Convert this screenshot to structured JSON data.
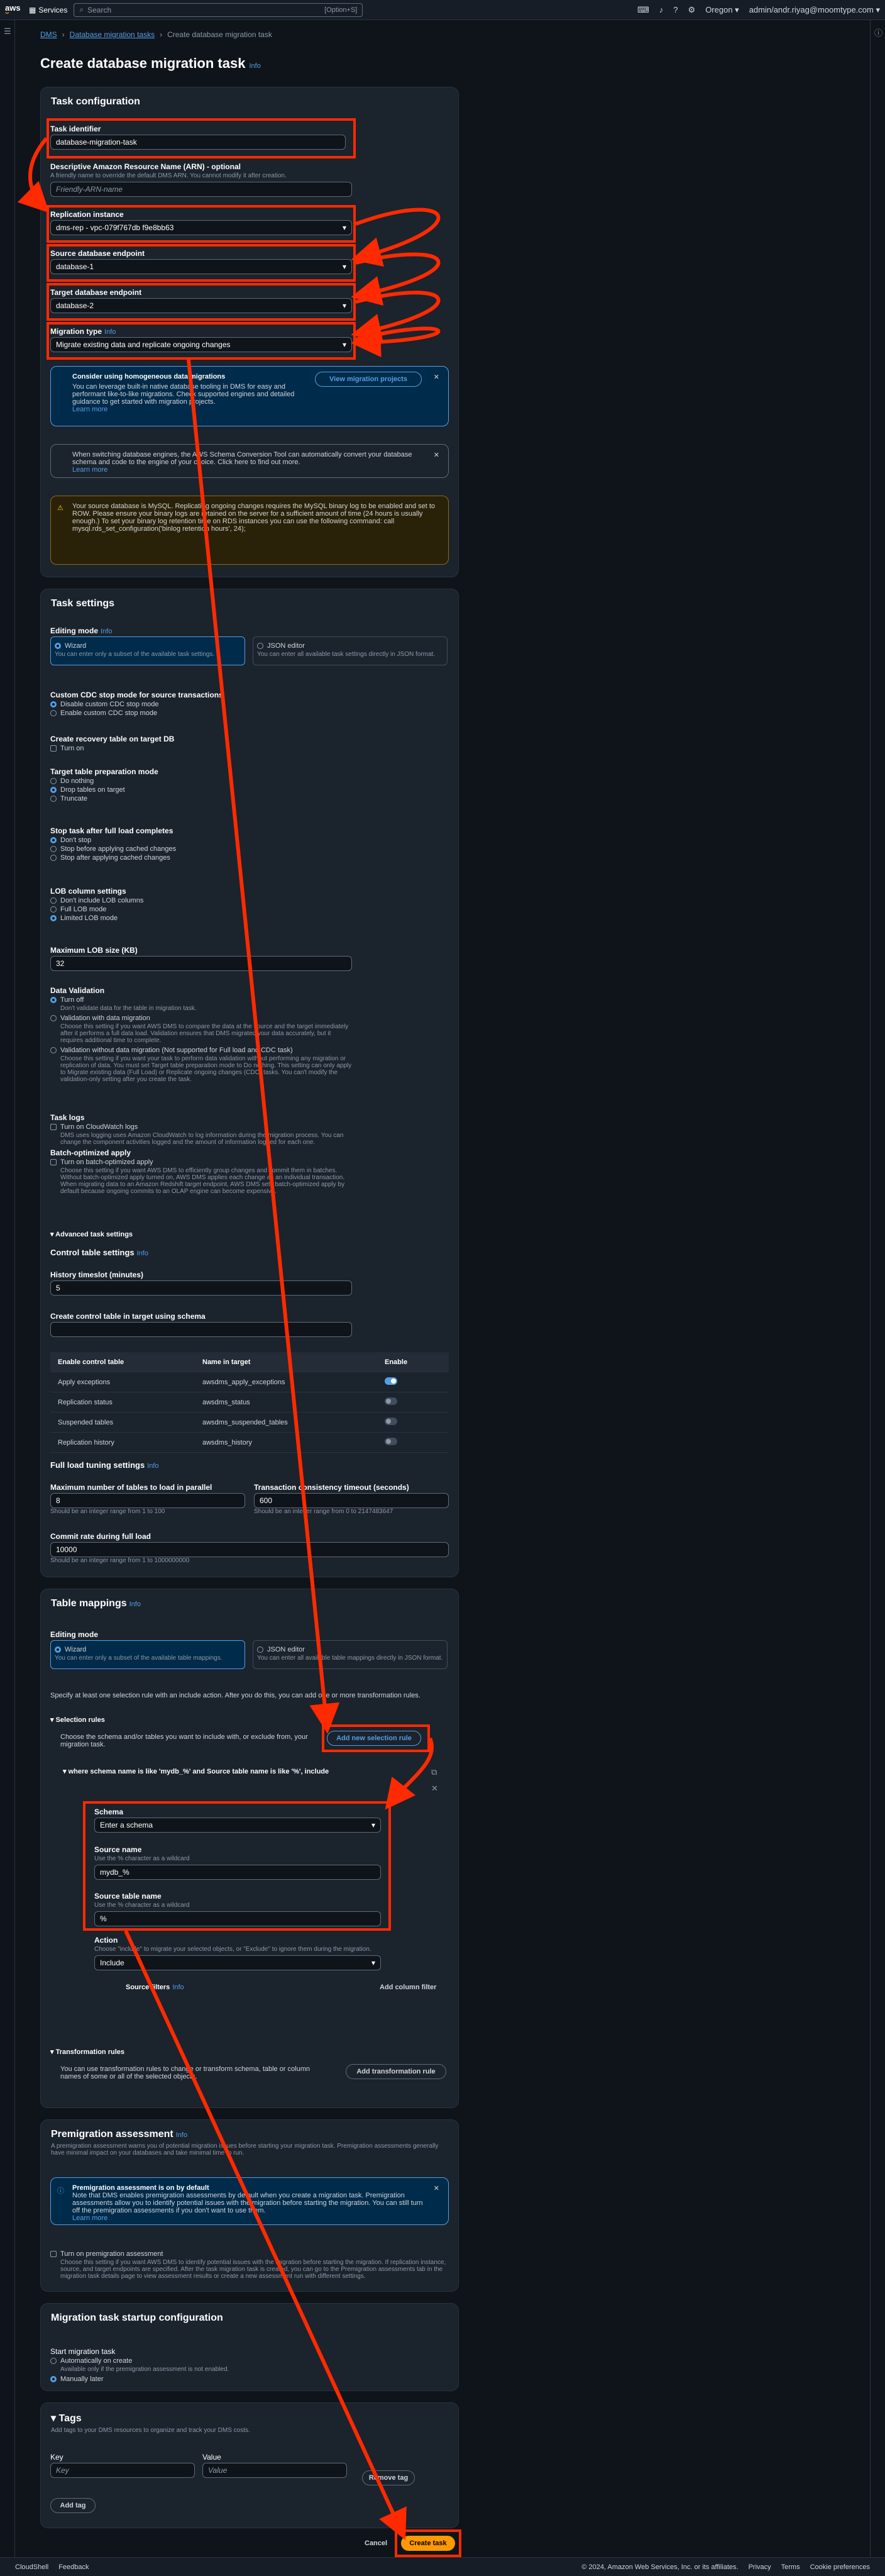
{
  "topbar": {
    "services": "Services",
    "search_placeholder": "Search",
    "search_hint": "[Option+S]",
    "region": "Oregon ▾",
    "account": "admin/andr.riyag@moomtype.com ▾"
  },
  "breadcrumb": [
    "DMS",
    "Database migration tasks",
    "Create database migration task"
  ],
  "page": {
    "title": "Create database migration task",
    "info": "Info"
  },
  "task_config": {
    "title": "Task configuration",
    "task_identifier": {
      "label": "Task identifier",
      "value": "database-migration-task"
    },
    "arn": {
      "label": "Descriptive Amazon Resource Name (ARN) - optional",
      "desc": "A friendly name to override the default DMS ARN. You cannot modify it after creation.",
      "placeholder": "Friendly-ARN-name"
    },
    "replication_instance": {
      "label": "Replication instance",
      "value": "dms-rep - vpc-079f767db f9e8bb63"
    },
    "source": {
      "label": "Source database endpoint",
      "value": "database-1"
    },
    "target": {
      "label": "Target database endpoint",
      "value": "database-2"
    },
    "migration_type": {
      "label": "Migration type",
      "value": "Migrate existing data and replicate ongoing changes"
    },
    "alert1": {
      "title": "Consider using homogeneous data migrations",
      "text": "You can leverage built-in native database tooling in DMS for easy and performant like-to-like migrations. Check supported engines and detailed guidance to get started with migration projects.",
      "link": "Learn more",
      "button": "View migration projects"
    },
    "alert2": {
      "text": "When switching database engines, the AWS Schema Conversion Tool can automatically convert your database schema and code to the engine of your choice. Click here to find out more.",
      "link": "Learn more"
    },
    "alert3": {
      "text": "Your source database is MySQL. Replicating ongoing changes requires the MySQL binary log to be enabled and set to ROW. Please ensure your binary logs are retained on the server for a sufficient amount of time (24 hours is usually enough.) To set your binary log retention time on RDS instances you can use the following command: call mysql.rds_set_configuration('binlog retention hours', 24);"
    }
  },
  "task_settings": {
    "title": "Task settings",
    "editing_mode": "Editing mode",
    "wizard": "Wizard",
    "wizard_desc": "You can enter only a subset of the available task settings.",
    "json": "JSON editor",
    "json_desc": "You can enter all available task settings directly in JSON format.",
    "cdc_label": "Custom CDC stop mode for source transactions",
    "cdc_opts": [
      "Disable custom CDC stop mode",
      "Enable custom CDC stop mode"
    ],
    "recovery_label": "Create recovery table on target DB",
    "recovery_opt": "Turn on",
    "prep_label": "Target table preparation mode",
    "prep_opts": [
      "Do nothing",
      "Drop tables on target",
      "Truncate"
    ],
    "stop_label": "Stop task after full load completes",
    "stop_opts": [
      "Don't stop",
      "Stop before applying cached changes",
      "Stop after applying cached changes"
    ],
    "lob_label": "LOB column settings",
    "lob_opts": [
      "Don't include LOB columns",
      "Full LOB mode",
      "Limited LOB mode"
    ],
    "maxlob_label": "Maximum LOB size (KB)",
    "maxlob_value": "32",
    "validation_label": "Data Validation",
    "val_off": "Turn off",
    "val_off_desc": "Don't validate data for the table in migration task.",
    "val_with": "Validation with data migration",
    "val_with_desc": "Choose this setting if you want AWS DMS to compare the data at the source and the target immediately after it performs a full data load. Validation ensures that DMS migrated your data accurately, but it requires additional time to complete.",
    "val_without": "Validation without data migration (Not supported for Full load and CDC task)",
    "val_without_desc": "Choose this setting if you want your task to perform data validation without performing any migration or replication of data. You must set Target table preparation mode to Do nothing. This setting can only apply to Migrate existing data (Full Load) or Replicate ongoing changes (CDC) tasks. You can't modify the validation-only setting after you create the task.",
    "logs_label": "Task logs",
    "logs_opt": "Turn on CloudWatch logs",
    "logs_desc": "DMS uses logging uses Amazon CloudWatch to log information during the migration process. You can change the component activities logged and the amount of information logged for each one.",
    "batch_label": "Batch-optimized apply",
    "batch_opt": "Turn on batch-optimized apply",
    "batch_desc": "Choose this setting if you want AWS DMS to efficiently group changes and commit them in batches. Without batch-optimized apply turned on, AWS DMS applies each change as an individual transaction. When migrating data to an Amazon Redshift target endpoint, AWS DMS sets batch-optimized apply by default because ongoing commits to an OLAP engine can become expensive.",
    "advanced": "Advanced task settings",
    "control_title": "Control table settings",
    "history_label": "History timeslot (minutes)",
    "history_value": "5",
    "schema_label": "Create control table in target using schema",
    "table_head": [
      "Enable control table",
      "Name in target",
      "Enable"
    ],
    "table_rows": [
      [
        "Apply exceptions",
        "awsdms_apply_exceptions"
      ],
      [
        "Replication status",
        "awsdms_status"
      ],
      [
        "Suspended tables",
        "awsdms_suspended_tables"
      ],
      [
        "Replication history",
        "awsdms_history"
      ]
    ],
    "full_load_title": "Full load tuning settings",
    "max_tables_label": "Maximum number of tables to load in parallel",
    "max_tables_value": "8",
    "max_tables_hint": "Should be an integer range from 1 to 100",
    "tx_label": "Transaction consistency timeout (seconds)",
    "tx_value": "600",
    "tx_hint": "Should be an integer range from 0 to 2147483647",
    "commit_label": "Commit rate during full load",
    "commit_value": "10000",
    "commit_hint": "Should be an integer range from 1 to 1000000000"
  },
  "table_mappings": {
    "title": "Table mappings",
    "editing_mode": "Editing mode",
    "spec": "Specify at least one selection rule with an include action. After you do this, you can add one or more transformation rules.",
    "selection_rules": "Selection rules",
    "sel_desc": "Choose the schema and/or tables you want to include with, or exclude from, your migration task.",
    "add_rule": "Add new selection rule",
    "rule_summary": "where schema name is like 'mydb_%' and Source table name is like '%', include",
    "schema_label": "Schema",
    "schema_value": "Enter a schema",
    "source_name_label": "Source name",
    "source_name_hint": "Use the % character as a wildcard",
    "source_name_value": "mydb_%",
    "source_table_label": "Source table name",
    "source_table_hint": "Use the % character as a wildcard",
    "source_table_value": "%",
    "action_label": "Action",
    "action_desc": "Choose \"include\" to migrate your selected objects, or \"Exclude\" to ignore them during the migration.",
    "action_value": "Include",
    "filters": "Source filters",
    "add_filter": "Add column filter",
    "transform_title": "Transformation rules",
    "transform_desc": "You can use transformation rules to change or transform schema, table or column names of some or all of the selected objects.",
    "add_transform": "Add transformation rule"
  },
  "premigration": {
    "title": "Premigration assessment",
    "desc": "A premigration assessment warns you of potential migration issues before starting your migration task. Premigration assessments generally have minimal impact on your databases and take minimal time to run.",
    "alert_title": "Premigration assessment is on by default",
    "alert_text": "Note that DMS enables premigration assessments by default when you create a migration task. Premigration assessments allow you to identify potential issues with the migration before starting the migration. You can still turn off the premigration assessments if you don't want to use them.",
    "link": "Learn more",
    "opt": "Turn on premigration assessment",
    "opt_desc": "Choose this setting if you want AWS DMS to identify potential issues with the migration before starting the migration. If replication instance, source, and target endpoints are specified. After the task migration task is created, you can go to the Premigration assessments tab in the migration task details page to view assessment results or create a new assessment run with different settings."
  },
  "startup": {
    "title": "Migration task startup configuration",
    "label": "Start migration task",
    "opt1": "Automatically on create",
    "opt1_desc": "Available only if the premigration assessment is not enabled.",
    "opt2": "Manually later"
  },
  "tags": {
    "title": "Tags",
    "desc": "Add tags to your DMS resources to organize and track your DMS costs.",
    "key": "Key",
    "value": "Value",
    "key_ph": "Key",
    "value_ph": "Value",
    "remove": "Remove tag",
    "add": "Add tag"
  },
  "actions": {
    "cancel": "Cancel",
    "create": "Create task"
  },
  "footer": {
    "left": [
      "CloudShell",
      "Feedback"
    ],
    "right": [
      "© 2024, Amazon Web Services, Inc. or its affiliates.",
      "Privacy",
      "Terms",
      "Cookie preferences"
    ]
  }
}
